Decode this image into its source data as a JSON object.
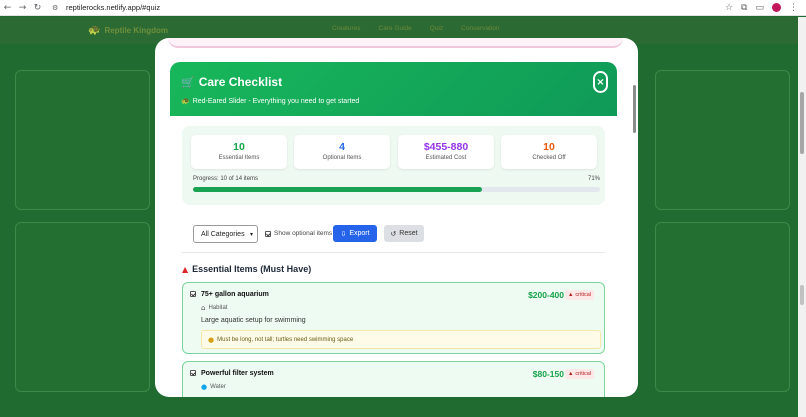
{
  "browser": {
    "url": "reptilerocks.netlify.app/#quiz"
  },
  "site": {
    "logo_text": "Reptile Kingdom",
    "nav": [
      "Creatures",
      "Care Guide",
      "Quiz",
      "Conservation"
    ]
  },
  "modal": {
    "title": "Care Checklist",
    "title_icon": "cart-icon",
    "subtitle": "Red-Eared Slider - Everything you need to get started",
    "close_label": "×",
    "stats": [
      {
        "value": "10",
        "label": "Essential Items",
        "color": "#16a34a"
      },
      {
        "value": "4",
        "label": "Optional Items",
        "color": "#2563eb"
      },
      {
        "value": "$455-880",
        "label": "Estimated Cost",
        "color": "#9333ea"
      },
      {
        "value": "10",
        "label": "Checked Off",
        "color": "#ea580c"
      }
    ],
    "progress": {
      "label": "Progress: 10 of 14 items",
      "percent_text": "71%",
      "fraction": 0.71
    },
    "controls": {
      "category_selected": "All Categories",
      "show_optional_label": "Show optional items",
      "export_label": "Export",
      "reset_label": "Reset"
    },
    "section_title": "Essential Items (Must Have)",
    "items": [
      {
        "name": "75+ gallon aquarium",
        "price": "$200-400",
        "badge": "critical",
        "category": "Habitat",
        "description": "Large aquatic setup for swimming",
        "tip": "Must be long, not tall; turtles need swimming space"
      },
      {
        "name": "Powerful filter system",
        "price": "$80-150",
        "badge": "critical",
        "category": "Water"
      }
    ]
  }
}
